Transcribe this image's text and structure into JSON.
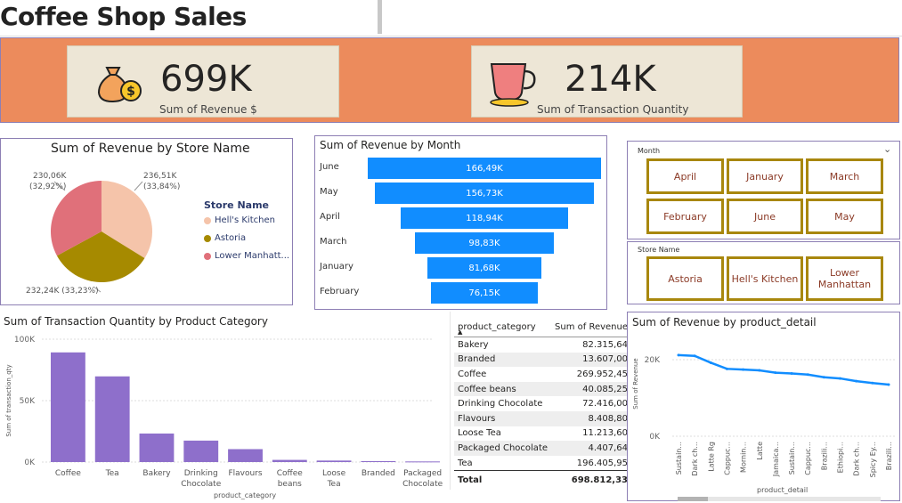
{
  "header": {
    "title": "Coffee Shop Sales"
  },
  "kpis": {
    "revenue": {
      "value": "699K",
      "label": "Sum of Revenue $"
    },
    "transactions": {
      "value": "214K",
      "label": "Sum of Transaction Quantity"
    }
  },
  "pie": {
    "title": "Sum of Revenue by Store Name",
    "legend_title": "Store Name",
    "slices": [
      {
        "name": "Hell's Kitchen",
        "value_label": "236,51K",
        "pct_label": "(33,84%)",
        "color": "#f5c4aa"
      },
      {
        "name": "Astoria",
        "value_label": "232,24K (33,23%)",
        "pct_label": "",
        "color": "#a68a00"
      },
      {
        "name": "Lower Manhatt...",
        "value_label": "230,06K",
        "pct_label": "(32,92%)",
        "color": "#e0707a"
      }
    ]
  },
  "funnel": {
    "title": "Sum of Revenue by Month",
    "rows": [
      {
        "label": "June",
        "value": "166,49K",
        "v": 166.49
      },
      {
        "label": "May",
        "value": "156,73K",
        "v": 156.73
      },
      {
        "label": "April",
        "value": "118,94K",
        "v": 118.94
      },
      {
        "label": "March",
        "value": "98,83K",
        "v": 98.83
      },
      {
        "label": "January",
        "value": "81,68K",
        "v": 81.68
      },
      {
        "label": "February",
        "value": "76,15K",
        "v": 76.15
      }
    ]
  },
  "slicer_month": {
    "title": "Month",
    "buttons": [
      "April",
      "January",
      "March",
      "February",
      "June",
      "May"
    ]
  },
  "slicer_store": {
    "title": "Store Name",
    "buttons": [
      "Astoria",
      "Hell's Kitchen",
      "Lower Manhattan"
    ]
  },
  "bar": {
    "title": "Sum of Transaction Quantity by Product Category",
    "ylabel": "Sum of transaction_qty",
    "xlabel": "product_category",
    "yticks": [
      "100K",
      "50K",
      "0K"
    ],
    "categories": [
      "Coffee",
      "Tea",
      "Bakery",
      "Drinking Chocolate",
      "Flavours",
      "Coffee beans",
      "Loose Tea",
      "Branded",
      "Packaged Chocolate"
    ],
    "values": [
      89250,
      69737,
      23214,
      17457,
      10511,
      1753,
      1210,
      776,
      487
    ],
    "color": "#8e6fcb"
  },
  "table": {
    "headers": [
      "product_category",
      "Sum of Revenue"
    ],
    "rows": [
      [
        "Bakery",
        "82.315,64"
      ],
      [
        "Branded",
        "13.607,00"
      ],
      [
        "Coffee",
        "269.952,45"
      ],
      [
        "Coffee beans",
        "40.085,25"
      ],
      [
        "Drinking Chocolate",
        "72.416,00"
      ],
      [
        "Flavours",
        "8.408,80"
      ],
      [
        "Loose Tea",
        "11.213,60"
      ],
      [
        "Packaged Chocolate",
        "4.407,64"
      ],
      [
        "Tea",
        "196.405,95"
      ]
    ],
    "total_label": "Total",
    "total_value": "698.812,33"
  },
  "line": {
    "title": "Sum of Revenue by product_detail",
    "ylabel": "Sum of Revenue",
    "xlabel": "product_detail",
    "yticks": [
      "20K",
      "0K"
    ],
    "categories": [
      "Sustain...",
      "Dark ch...",
      "Latte Rg",
      "Cappuc...",
      "Mornin...",
      "Latte",
      "Jamaica...",
      "Sustain...",
      "Cappuc...",
      "Brazili...",
      "Ethiopi...",
      "Dark ch...",
      "Spicy Ey...",
      "Brazili..."
    ],
    "values": [
      21.2,
      21,
      19.2,
      17.6,
      17.4,
      17.2,
      16.6,
      16.4,
      16.1,
      15.4,
      15.1,
      14.4,
      13.9,
      13.5
    ],
    "ylim": [
      0,
      30
    ],
    "color": "#118dff"
  }
}
